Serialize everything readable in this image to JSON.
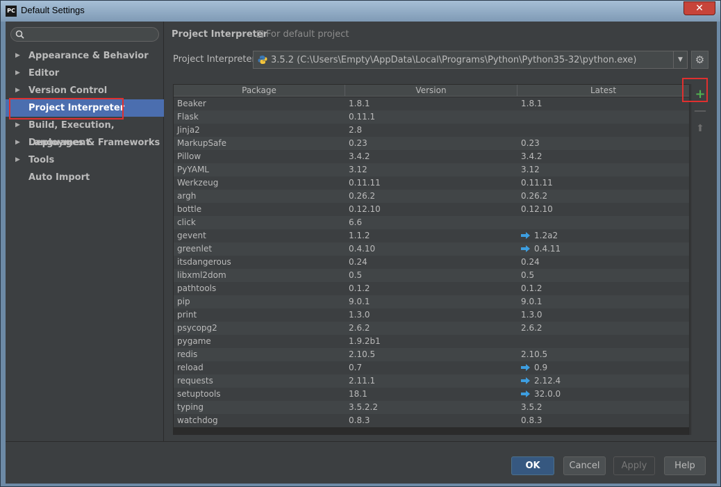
{
  "window": {
    "title": "Default Settings",
    "app_icon": "PC"
  },
  "search": {
    "placeholder": ""
  },
  "sidebar": {
    "items": [
      {
        "label": "Appearance & Behavior",
        "expandable": true
      },
      {
        "label": "Editor",
        "expandable": true
      },
      {
        "label": "Version Control",
        "expandable": true
      },
      {
        "label": "Project Interpreter",
        "expandable": false,
        "selected": true
      },
      {
        "label": "Build, Execution, Deployment",
        "expandable": true
      },
      {
        "label": "Languages & Frameworks",
        "expandable": true
      },
      {
        "label": "Tools",
        "expandable": true
      },
      {
        "label": "Auto Import",
        "expandable": false
      }
    ]
  },
  "header": {
    "title": "Project Interpreter",
    "subtitle": "For default project"
  },
  "interpreter": {
    "label": "Project Interpreter:",
    "value": "3.5.2 (C:\\Users\\Empty\\AppData\\Local\\Programs\\Python\\Python35-32\\python.exe)"
  },
  "table": {
    "columns": [
      "Package",
      "Version",
      "Latest"
    ],
    "rows": [
      {
        "package": "Beaker",
        "version": "1.8.1",
        "latest": "1.8.1",
        "upgrade": false
      },
      {
        "package": "Flask",
        "version": "0.11.1",
        "latest": "",
        "upgrade": false
      },
      {
        "package": "Jinja2",
        "version": "2.8",
        "latest": "",
        "upgrade": false
      },
      {
        "package": "MarkupSafe",
        "version": "0.23",
        "latest": "0.23",
        "upgrade": false
      },
      {
        "package": "Pillow",
        "version": "3.4.2",
        "latest": "3.4.2",
        "upgrade": false
      },
      {
        "package": "PyYAML",
        "version": "3.12",
        "latest": "3.12",
        "upgrade": false
      },
      {
        "package": "Werkzeug",
        "version": "0.11.11",
        "latest": "0.11.11",
        "upgrade": false
      },
      {
        "package": "argh",
        "version": "0.26.2",
        "latest": "0.26.2",
        "upgrade": false
      },
      {
        "package": "bottle",
        "version": "0.12.10",
        "latest": "0.12.10",
        "upgrade": false
      },
      {
        "package": "click",
        "version": "6.6",
        "latest": "",
        "upgrade": false
      },
      {
        "package": "gevent",
        "version": "1.1.2",
        "latest": "1.2a2",
        "upgrade": true
      },
      {
        "package": "greenlet",
        "version": "0.4.10",
        "latest": "0.4.11",
        "upgrade": true
      },
      {
        "package": "itsdangerous",
        "version": "0.24",
        "latest": "0.24",
        "upgrade": false
      },
      {
        "package": "libxml2dom",
        "version": "0.5",
        "latest": "0.5",
        "upgrade": false
      },
      {
        "package": "pathtools",
        "version": "0.1.2",
        "latest": "0.1.2",
        "upgrade": false
      },
      {
        "package": "pip",
        "version": "9.0.1",
        "latest": "9.0.1",
        "upgrade": false
      },
      {
        "package": "print",
        "version": "1.3.0",
        "latest": "1.3.0",
        "upgrade": false
      },
      {
        "package": "psycopg2",
        "version": "2.6.2",
        "latest": "2.6.2",
        "upgrade": false
      },
      {
        "package": "pygame",
        "version": "1.9.2b1",
        "latest": "",
        "upgrade": false
      },
      {
        "package": "redis",
        "version": "2.10.5",
        "latest": "2.10.5",
        "upgrade": false
      },
      {
        "package": "reload",
        "version": "0.7",
        "latest": "0.9",
        "upgrade": true
      },
      {
        "package": "requests",
        "version": "2.11.1",
        "latest": "2.12.4",
        "upgrade": true
      },
      {
        "package": "setuptools",
        "version": "18.1",
        "latest": "32.0.0",
        "upgrade": true
      },
      {
        "package": "typing",
        "version": "3.5.2.2",
        "latest": "3.5.2",
        "upgrade": false
      },
      {
        "package": "watchdog",
        "version": "0.8.3",
        "latest": "0.8.3",
        "upgrade": false
      }
    ]
  },
  "tools": {
    "add": "+",
    "remove": "—",
    "upgrade": "⬆"
  },
  "buttons": {
    "ok": "OK",
    "cancel": "Cancel",
    "apply": "Apply",
    "help": "Help"
  },
  "colors": {
    "selection": "#4b6eaf",
    "highlight_box": "#e0302f",
    "add": "#50b050",
    "upgrade_arrow": "#3d9ee0"
  }
}
